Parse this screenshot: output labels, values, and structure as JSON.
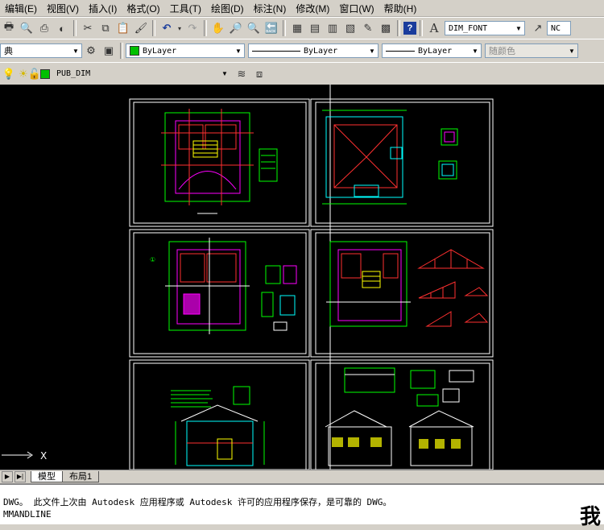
{
  "menubar": {
    "items": [
      "编辑(E)",
      "视图(V)",
      "插入(I)",
      "格式(O)",
      "工具(T)",
      "绘图(D)",
      "标注(N)",
      "修改(M)",
      "窗口(W)",
      "帮助(H)"
    ]
  },
  "toolbar_styles": {
    "text_style_prefix": "A",
    "text_style_value": "DIM_FONT",
    "dim_style_partial": "NC"
  },
  "properties": {
    "layer_partial": "典",
    "color_value": "ByLayer",
    "linetype_value": "ByLayer",
    "lineweight_value": "ByLayer",
    "plotstyle_value": "随颜色"
  },
  "layer_toolbar": {
    "current_layer": "PUB_DIM"
  },
  "colors": {
    "canvas_bg": "#000000",
    "sheet_border": "#ffffff",
    "plan_green": "#00ff00",
    "plan_magenta": "#ff00ff",
    "plan_cyan": "#00ffff",
    "plan_yellow": "#ffff00",
    "plan_red": "#ff3030"
  },
  "ucs": {
    "x_label": "X"
  },
  "tabs": {
    "model": "模型",
    "layout1": "布局1"
  },
  "command": {
    "line1": " DWG。   此文件上次由 Autodesk 应用程序或 Autodesk 许可的应用程序保存，是可靠的 DWG。",
    "line2": "MMANDLINE",
    "big_char": "我"
  }
}
